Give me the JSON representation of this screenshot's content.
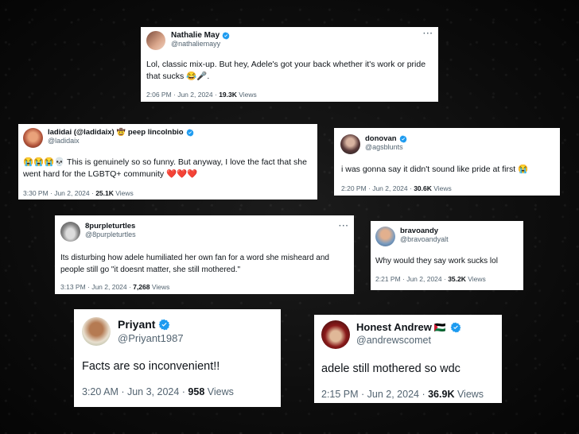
{
  "tweets": [
    {
      "name": "Nathalie May",
      "handle": "@nathaliemayy",
      "text": "Lol, classic mix-up. But hey, Adele's got your back whether it's work or pride that sucks",
      "emojis": "😂🎤.",
      "time": "2:06 PM · Jun 2, 2024 · ",
      "views": "19.3K",
      "views_label": " Views"
    },
    {
      "name": "ladidai (@ladidaix)",
      "name_suffix": "peep lincolnbio",
      "handle": "@ladidaix",
      "text_emojis": "😭😭😭💀",
      "text": " This is genuinely so so funny. But anyway, I love the fact that she went hard for the LGBTQ+ community",
      "emojis": "❤️❤️❤️",
      "time": "3:30 PM · Jun 2, 2024 · ",
      "views": "25.1K",
      "views_label": " Views"
    },
    {
      "name": "donovan",
      "handle": "@agsblunts",
      "text": "i was gonna say it didn't sound like pride at first",
      "emojis": "😭",
      "time": "2:20 PM · Jun 2, 2024 · ",
      "views": "30.6K",
      "views_label": " Views"
    },
    {
      "name": "8purpleturtles",
      "handle": "@8purpleturtles",
      "text": "Its disturbing how adele humiliated her own fan for a word she misheard and people still go \"it doesnt matter, she still mothered.\"",
      "time": "3:13 PM · Jun 2, 2024 · ",
      "views": "7,268",
      "views_label": " Views"
    },
    {
      "name": "bravoandy",
      "handle": "@bravoandyalt",
      "text": "Why would they say work sucks lol",
      "time": "2:21 PM · Jun 2, 2024 · ",
      "views": "35.2K",
      "views_label": " Views"
    },
    {
      "name": "Priyant",
      "handle": "@Priyant1987",
      "text": "Facts are so inconvenient!!",
      "time": "3:20 AM · Jun 3, 2024 · ",
      "views": "958",
      "views_label": " Views"
    },
    {
      "name": "Honest Andrew",
      "handle": "@andrewscomet",
      "text": "adele still mothered so wdc",
      "time": "2:15 PM · Jun 2, 2024 · ",
      "views": "36.9K",
      "views_label": " Views"
    }
  ],
  "more_label": "···",
  "icons": {
    "verified": "verified-badge-icon",
    "more": "more-options-icon"
  },
  "colors": {
    "verified_blue": "#1d9bf0",
    "text_primary": "#0f1419",
    "text_secondary": "#536471"
  }
}
